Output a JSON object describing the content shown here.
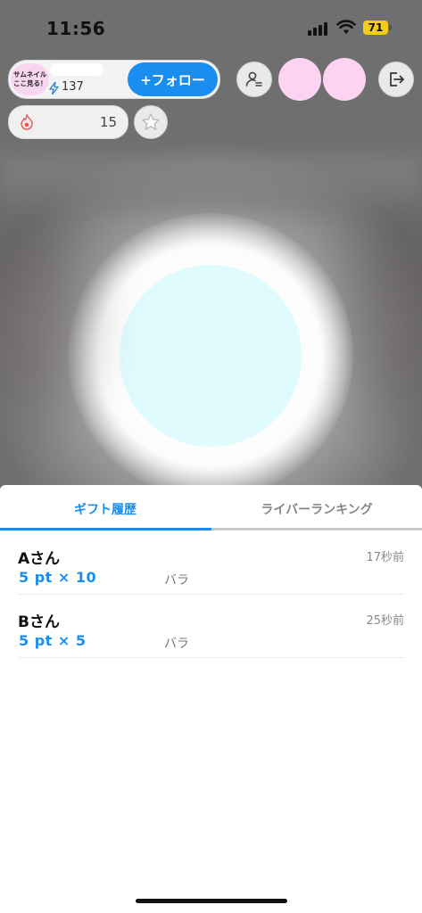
{
  "status_bar": {
    "time": "11:56",
    "battery": "71"
  },
  "streamer": {
    "thumbnail_text_line1": "サムネイル",
    "thumbnail_text_line2": "ここ見る！",
    "follower_count": "137",
    "follow_label": "+フォロー"
  },
  "points": {
    "value": "15"
  },
  "tabs": [
    {
      "label": "ギフト履歴",
      "active": true
    },
    {
      "label": "ライバーランキング",
      "active": false
    }
  ],
  "gift_history": [
    {
      "user": "Aさん",
      "time": "17秒前",
      "amount": "5 pt × 10",
      "item": "バラ"
    },
    {
      "user": "Bさん",
      "time": "25秒前",
      "amount": "5 pt × 5",
      "item": "バラ"
    }
  ],
  "colors": {
    "accent": "#1a8ef0",
    "orb": "#dffbfd",
    "avatar": "#fdd3f1"
  },
  "icons": [
    "bolt-icon",
    "user-list-icon",
    "exit-icon",
    "flame-icon",
    "star-icon",
    "wifi-icon",
    "signal-icon"
  ]
}
